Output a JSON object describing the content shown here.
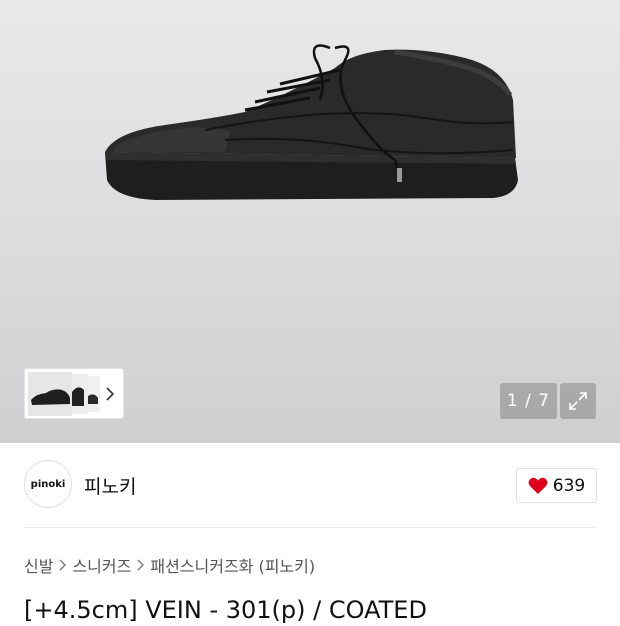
{
  "gallery": {
    "counter": "1 / 7",
    "thumbnail_label": "",
    "expand_icon": "expand-icon"
  },
  "brand": {
    "logo_text": "pinoki",
    "name": "피노키"
  },
  "like": {
    "count": "639",
    "color": "#e0001b"
  },
  "breadcrumb": {
    "items": [
      "신발",
      "스니커즈",
      "패션스니커즈화 (피노키)"
    ]
  },
  "product": {
    "title": "[+4.5cm] VEIN - 301(p) / COATED"
  }
}
